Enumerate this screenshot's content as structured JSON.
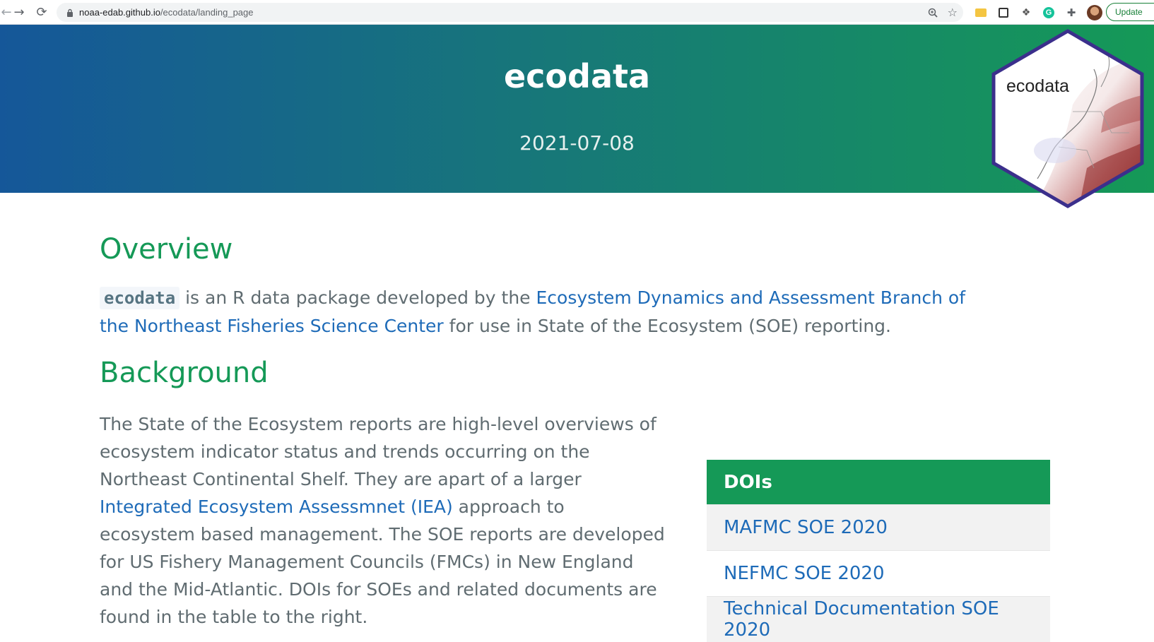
{
  "browser": {
    "url_host": "noaa-edab.github.io",
    "url_path": "/ecodata/landing_page",
    "update_label": "Update"
  },
  "header": {
    "title": "ecodata",
    "date": "2021-07-08",
    "logo_text": "ecodata"
  },
  "overview": {
    "heading": "Overview",
    "pkg_name": "ecodata",
    "text_1": " is an R data package developed by the ",
    "link_text": "Ecosystem Dynamics and Assessment Branch of the Northeast Fisheries Science Center",
    "text_2": " for use in State of the Ecosystem (SOE) reporting."
  },
  "background": {
    "heading": "Background",
    "text_1": "The State of the Ecosystem reports are high-level overviews of ecosystem indicator status and trends occurring on the Northeast Continental Shelf. They are apart of a larger ",
    "link_text": "Integrated Ecosystem Assessmnet (IEA)",
    "text_2": " approach to ecosystem based management. The SOE reports are developed for US Fishery Management Councils (FMCs) in New England and the Mid-Atlantic. DOIs for SOEs and related documents are found in the table to the right."
  },
  "doi_table": {
    "header": "DOIs",
    "rows": [
      {
        "label": "MAFMC SOE 2020"
      },
      {
        "label": "NEFMC SOE 2020"
      },
      {
        "label": "Technical Documentation SOE 2020"
      }
    ]
  },
  "colors": {
    "accent_green": "#159957",
    "accent_blue": "#155799",
    "link": "#1e6bb8"
  }
}
